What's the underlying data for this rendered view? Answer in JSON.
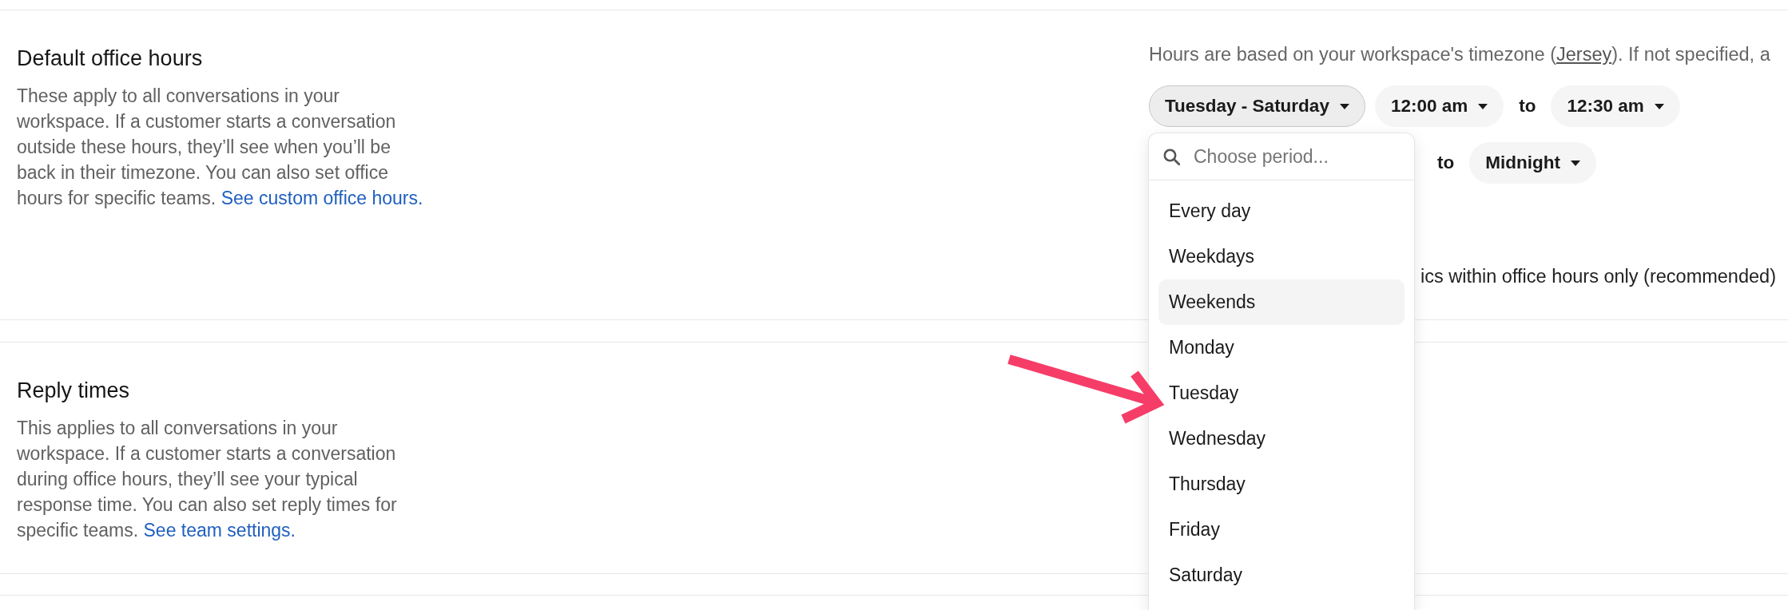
{
  "sections": [
    {
      "kind": "schedule",
      "title": "Default office hours",
      "description": "These apply to all conversations in your workspace. If a customer starts a conversation outside these hours, they’ll see when you’ll be back in their timezone. You can also set office hours for specific teams.",
      "link": "See custom office hours.",
      "timezone_note": {
        "before": "Hours are based on your workspace's timezone (",
        "link": "Jersey",
        "after": "). If not specified, a"
      },
      "schedule_rows": [
        {
          "period": {
            "label": "Tuesday - Saturday",
            "expanded": true,
            "menu": {
              "search": {
                "placeholder": "Choose period..."
              },
              "items": [
                {
                  "label": "Every day",
                  "highlighted": false
                },
                {
                  "label": "Weekdays",
                  "highlighted": false
                },
                {
                  "label": "Weekends",
                  "highlighted": true
                },
                {
                  "label": "Monday",
                  "highlighted": false
                },
                {
                  "label": "Tuesday",
                  "highlighted": false
                },
                {
                  "label": "Wednesday",
                  "highlighted": false
                },
                {
                  "label": "Thursday",
                  "highlighted": false
                },
                {
                  "label": "Friday",
                  "highlighted": false
                },
                {
                  "label": "Saturday",
                  "highlighted": false
                }
              ]
            }
          },
          "start": "12:00 am",
          "separator": "to",
          "end": "12:30 am"
        },
        {
          "separator": "to",
          "end": "Midnight"
        }
      ],
      "checkbox_label": "ics within office hours only (recommended)"
    },
    {
      "kind": "plain",
      "title": "Reply times",
      "description": "This applies to all conversations in your workspace. If a customer starts a conversation during office hours, they’ll see your typical response time. You can also set reply times for specific teams.",
      "link": "See team settings."
    }
  ],
  "annotations": [
    {
      "kind": "arrow"
    }
  ]
}
